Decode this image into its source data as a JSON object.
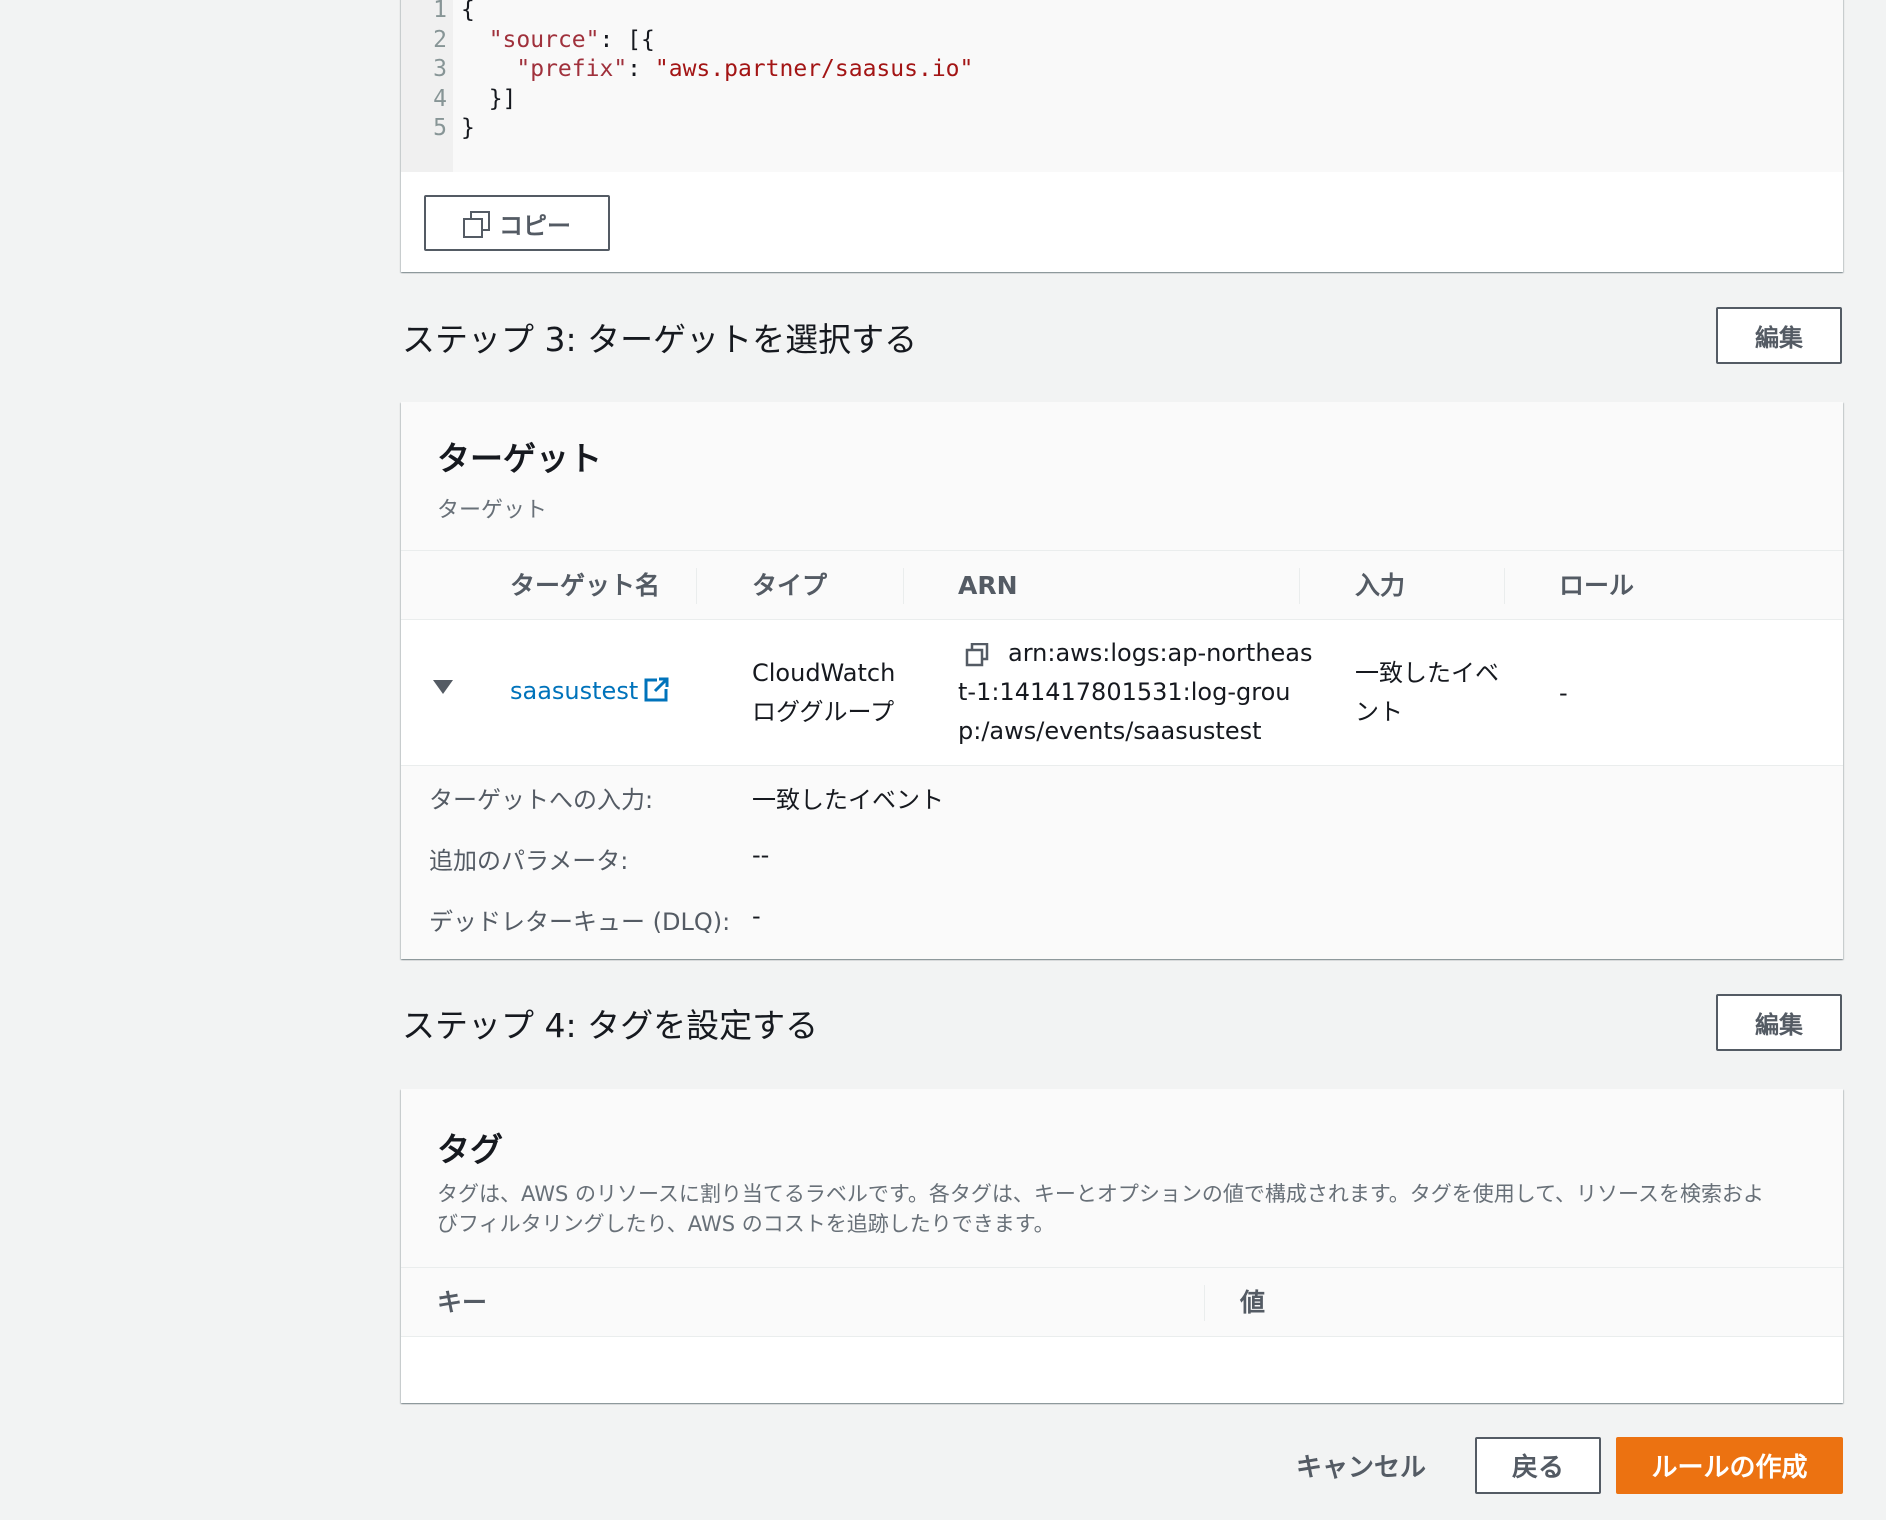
{
  "code": {
    "line_numbers": [
      "1",
      "2",
      "3",
      "4",
      "5"
    ],
    "lines": [
      [
        {
          "t": "{",
          "c": "p"
        }
      ],
      [
        {
          "t": "  ",
          "c": "p"
        },
        {
          "t": "\"source\"",
          "c": "k"
        },
        {
          "t": ": [{",
          "c": "p"
        }
      ],
      [
        {
          "t": "    ",
          "c": "p"
        },
        {
          "t": "\"prefix\"",
          "c": "k"
        },
        {
          "t": ": ",
          "c": "p"
        },
        {
          "t": "\"aws.partner/saasus.io\"",
          "c": "s"
        }
      ],
      [
        {
          "t": "  }]",
          "c": "p"
        }
      ],
      [
        {
          "t": "}",
          "c": "p"
        }
      ]
    ],
    "copy_label": "コピー"
  },
  "step3": {
    "title": "ステップ 3: ターゲットを選択する",
    "edit_label": "編集",
    "panel_title": "ターゲット",
    "panel_subtitle": "ターゲット",
    "columns": [
      "ターゲット名",
      "タイプ",
      "ARN",
      "入力",
      "ロール"
    ],
    "row": {
      "name": "saasustest",
      "type_line1": "CloudWatch",
      "type_line2": "ロググループ",
      "arn_line1": "arn:aws:logs:ap-northeas",
      "arn_line2": "t-1:141417801531:log-grou",
      "arn_line3": "p:/aws/events/saasustest",
      "input_line1": "一致したイベ",
      "input_line2": "ント",
      "role": "-"
    },
    "details": [
      {
        "label": "ターゲットへの入力:",
        "value": "一致したイベント"
      },
      {
        "label": "追加のパラメータ:",
        "value": "--"
      },
      {
        "label": "デッドレターキュー (DLQ):",
        "value": "-"
      }
    ]
  },
  "step4": {
    "title": "ステップ 4: タグを設定する",
    "edit_label": "編集",
    "panel_title": "タグ",
    "description_line1": "タグは、AWS のリソースに割り当てるラベルです。各タグは、キーとオプションの値で構成されます。タグを使用して、リソースを検索およ",
    "description_line2": "びフィルタリングしたり、AWS のコストを追跡したりできます。",
    "columns": [
      "キー",
      "値"
    ]
  },
  "footer": {
    "cancel_label": "キャンセル",
    "back_label": "戻る",
    "create_label": "ルールの作成"
  },
  "colors": {
    "link": "#0073bb",
    "primary": "#ec7211",
    "background": "#f2f3f3"
  }
}
